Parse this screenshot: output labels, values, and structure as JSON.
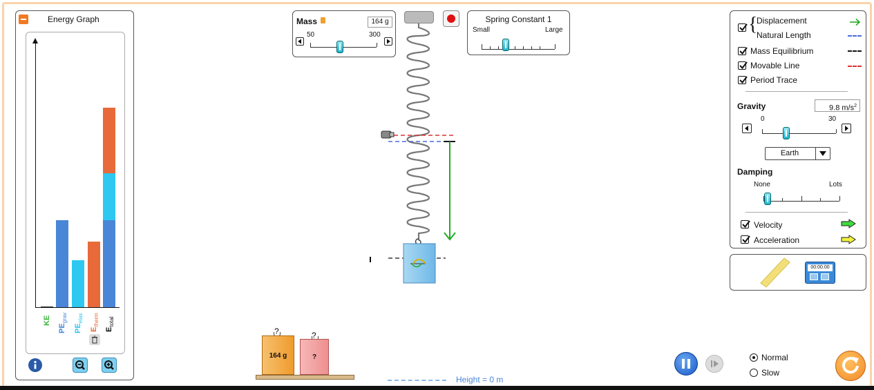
{
  "energy_graph": {
    "title": "Energy Graph",
    "bars": [
      {
        "label": "KE",
        "sub": "",
        "value": 0,
        "color": "#3cb43c"
      },
      {
        "label": "PE",
        "sub": "grav",
        "value": 1,
        "color": "#4a86d8"
      },
      {
        "label": "PE",
        "sub": "elas",
        "value": 1,
        "color": "#2ec8f0"
      },
      {
        "label": "E",
        "sub": "therm",
        "value": 1,
        "color": "#e86a3a"
      },
      {
        "label": "E",
        "sub": "total",
        "value": 1,
        "color": "#111111"
      }
    ]
  },
  "mass_control": {
    "label": "Mass",
    "value": "164 g",
    "min": "50",
    "max": "300"
  },
  "spring_constant": {
    "label": "Spring Constant 1",
    "min_label": "Small",
    "max_label": "Large"
  },
  "options": {
    "displacement": "Displacement",
    "natural_length": "Natural Length",
    "mass_equilibrium": "Mass Equilibrium",
    "movable_line": "Movable Line",
    "period_trace": "Period Trace",
    "gravity_label": "Gravity",
    "gravity_value": "9.8 m/s",
    "gravity_unit_sup": "2",
    "gravity_min": "0",
    "gravity_max": "30",
    "planet": "Earth",
    "damping_label": "Damping",
    "damping_min": "None",
    "damping_max": "Lots",
    "velocity": "Velocity",
    "acceleration": "Acceleration"
  },
  "timer": {
    "display": "00:00.00"
  },
  "masses": [
    {
      "label": "164 g",
      "question": "?"
    },
    {
      "label": "?",
      "question": "?"
    }
  ],
  "height_label": "Height = 0 m",
  "speed": {
    "normal": "Normal",
    "slow": "Slow",
    "selected": "Normal"
  },
  "colors": {
    "accent": "#f28c28",
    "velocity": "#3ddc3d",
    "acceleration": "#f2f23a",
    "displacement": "#22aa22"
  }
}
